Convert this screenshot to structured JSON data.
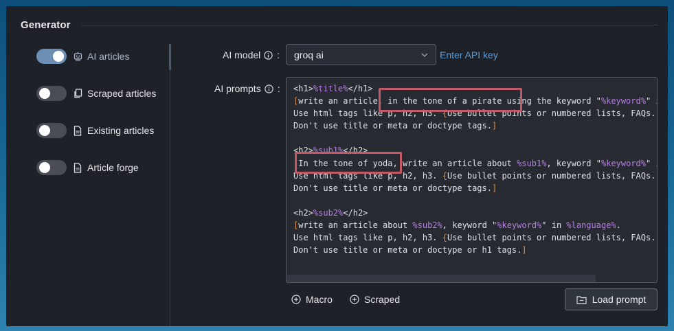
{
  "section": {
    "title": "Generator"
  },
  "nav": {
    "items": [
      {
        "label": "AI articles",
        "on": true,
        "icon": "robot-icon"
      },
      {
        "label": "Scraped articles",
        "on": false,
        "icon": "copy-doc-icon"
      },
      {
        "label": "Existing articles",
        "on": false,
        "icon": "document-icon"
      },
      {
        "label": "Article forge",
        "on": false,
        "icon": "document-icon"
      }
    ]
  },
  "form": {
    "model_label": "AI model",
    "model_value": "groq ai",
    "api_link": "Enter API key",
    "prompts_label": "AI prompts",
    "colon": ":"
  },
  "prompt": {
    "h1_open": "<h1>",
    "h1_macro": "%title%",
    "h1_close": "</h1>",
    "l2_a": "write an article, in the tone of a pirate using the keyword \"",
    "l2_macro": "%keyword%",
    "l2_b": "\" i",
    "l3_a": "Use html tags like p, h2, h3. ",
    "l3_b": "Use bullet points or numbered lists, FAQs.",
    "l3_c": "|",
    "l4": "Don't use title or meta or doctype tags.",
    "h2a_open": "<h2>",
    "h2a_macro": "%sub1%",
    "h2a_close": "</h2>",
    "l6_a": "In the tone of yoda, write an article about ",
    "l6_macro1": "%sub1%",
    "l6_b": ", keyword \"",
    "l6_macro2": "%keyword%",
    "l6_c": "\" i",
    "l7_a": "Use html tags like p, h2, h3. ",
    "l7_b": "Use bullet points or numbered lists, FAQs.|",
    "l8": "Don't use title or meta or doctype tags.",
    "h2b_open": "<h2>",
    "h2b_macro": "%sub2%",
    "h2b_close": "</h2>",
    "l10_a": "write an article about ",
    "l10_macro1": "%sub2%",
    "l10_b": ", keyword \"",
    "l10_macro2": "%keyword%",
    "l10_c": "\" in ",
    "l10_macro3": "%language%",
    "l10_d": ".",
    "l11_a": "Use html tags like p, h2, h3. ",
    "l11_b": "Use bullet points or numbered lists, FAQs.|",
    "l12": "Don't use title or meta or doctype or h1 tags.",
    "open_bracket": "[",
    "close_bracket": "]",
    "open_brace": "{",
    "close_brace": "}"
  },
  "actions": {
    "macro_label": "Macro",
    "scraped_label": "Scraped",
    "load_label": "Load prompt"
  },
  "colors": {
    "macro": "#b57fe0",
    "bracket": "#e48b3c",
    "highlight": "#c25a68",
    "link": "#5b9bd5"
  }
}
